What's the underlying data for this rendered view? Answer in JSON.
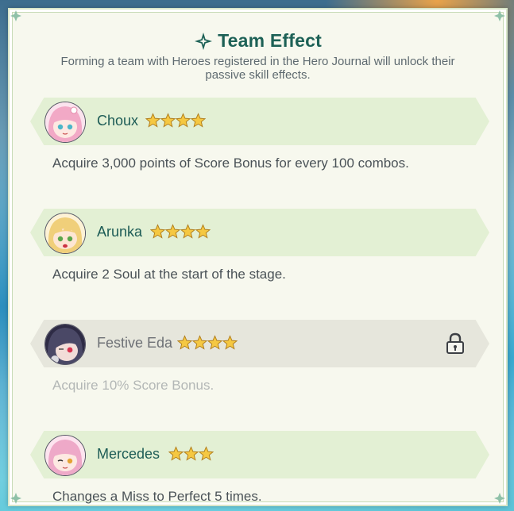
{
  "header": {
    "title": "Team Effect",
    "title_icon": "sparkle-icon",
    "subtitle": "Forming a team with Heroes registered in the Hero Journal will unlock their passive skill effects."
  },
  "heroes": [
    {
      "name": "Choux",
      "stars": 4,
      "effect": "Acquire 3,000 points of Score Bonus for every 100 combos.",
      "locked": false,
      "avatar_color": "#f2b8cf"
    },
    {
      "name": "Arunka",
      "stars": 4,
      "effect": "Acquire 2 Soul at the start of the stage.",
      "locked": false,
      "avatar_color": "#f1d58a"
    },
    {
      "name": "Festive Eda",
      "stars": 4,
      "effect": "Acquire 10% Score Bonus.",
      "locked": true,
      "avatar_color": "#4a4866"
    },
    {
      "name": "Mercedes",
      "stars": 3,
      "effect": "Changes a Miss to Perfect 5 times.",
      "locked": false,
      "avatar_color": "#f3b8d3"
    }
  ],
  "colors": {
    "accent": "#1d6156",
    "banner": "#e3f0d4",
    "banner_locked": "#e6e6dc",
    "star": "#f5c842"
  }
}
